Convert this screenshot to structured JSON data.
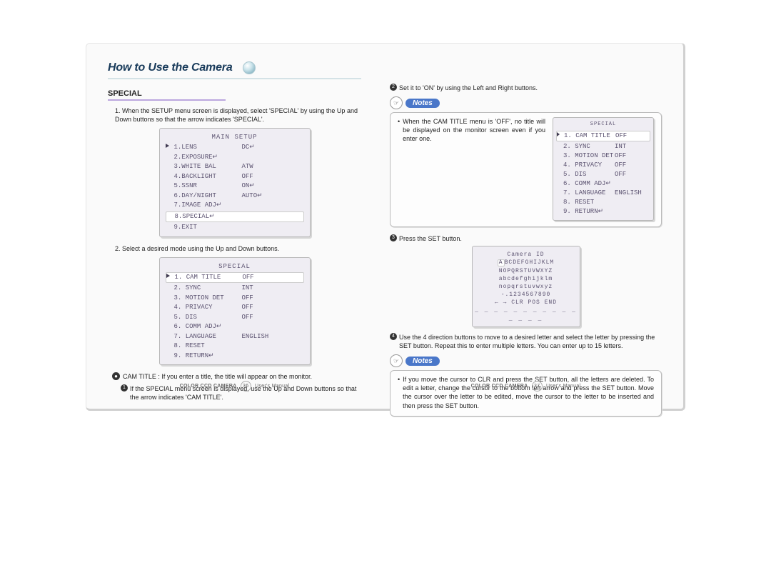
{
  "header": {
    "title": "How to Use the Camera"
  },
  "left": {
    "section_heading": "SPECIAL",
    "step1": "When the SETUP menu screen is displayed, select 'SPECIAL' by using the Up and Down buttons so that the arrow indicates 'SPECIAL'.",
    "main_setup": {
      "title": "MAIN SETUP",
      "rows": [
        {
          "k": "1.LENS",
          "v": "DC↵",
          "ptr": true,
          "hl": false
        },
        {
          "k": "2.EXPOSURE↵",
          "v": ""
        },
        {
          "k": "3.WHITE BAL",
          "v": "ATW"
        },
        {
          "k": "4.BACKLIGHT",
          "v": "OFF"
        },
        {
          "k": "5.SSNR",
          "v": "ON↵"
        },
        {
          "k": "6.DAY/NIGHT",
          "v": "AUTO↵"
        },
        {
          "k": "7.IMAGE ADJ↵",
          "v": ""
        },
        {
          "k": "8.SPECIAL↵",
          "v": "",
          "hl": true
        },
        {
          "k": "9.EXIT",
          "v": ""
        }
      ]
    },
    "step2": "Select a desired mode using the Up and Down buttons.",
    "special_menu": {
      "title": "SPECIAL",
      "rows": [
        {
          "k": "1. CAM TITLE",
          "v": "OFF",
          "ptr": true,
          "hl": true
        },
        {
          "k": "2. SYNC",
          "v": "INT"
        },
        {
          "k": "3. MOTION DET",
          "v": "OFF"
        },
        {
          "k": "4. PRIVACY",
          "v": "OFF"
        },
        {
          "k": "5. DIS",
          "v": "OFF"
        },
        {
          "k": "6. COMM ADJ↵",
          "v": ""
        },
        {
          "k": "7. LANGUAGE",
          "v": "ENGLISH"
        },
        {
          "k": "8. RESET",
          "v": ""
        },
        {
          "k": "9. RETURN↵",
          "v": ""
        }
      ]
    },
    "cam_title_line": "CAM TITLE : If you enter a title, the title will appear on the monitor.",
    "cam_title_sub1": "If the SPECIAL menu screen is displayed, use the Up and Down buttons so that the arrow indicates 'CAM TITLE'."
  },
  "right": {
    "step2": "Set it to 'ON' by using the Left and Right buttons.",
    "notes_label": "Notes",
    "note1_text": "When the CAM TITLE menu is 'OFF', no title will be displayed on the monitor screen even if you enter one.",
    "special_small": {
      "title": "SPECIAL",
      "rows": [
        {
          "k": "1. CAM TITLE",
          "v": "OFF",
          "ptr": true,
          "hl": true
        },
        {
          "k": "2. SYNC",
          "v": "INT"
        },
        {
          "k": "3. MOTION DET",
          "v": "OFF"
        },
        {
          "k": "4. PRIVACY",
          "v": "OFF"
        },
        {
          "k": "5. DIS",
          "v": "OFF"
        },
        {
          "k": "6. COMM ADJ↵",
          "v": ""
        },
        {
          "k": "7. LANGUAGE",
          "v": "ENGLISH"
        },
        {
          "k": "8. RESET",
          "v": ""
        },
        {
          "k": "9. RETURN↵",
          "v": ""
        }
      ]
    },
    "step3": "Press the SET button.",
    "camera_id": {
      "title": "Camera ID",
      "line1_sel": "A",
      "line1_rest": "BCDEFGHIJKLM",
      "line2": "NOPQRSTUVWXYZ",
      "line3": "abcdefghijklm",
      "line4": "nopqrstuvwxyz",
      "line5": "-.1234567890",
      "line6": "← → CLR POS END",
      "line7": "_ _ _ _ _ _ _ _ _ _ _ _ _ _ _"
    },
    "step4": "Use the 4 direction buttons to move to a desired letter and select the letter by pressing the SET button. Repeat this to enter multiple letters. You can enter up to 15 letters.",
    "note2_text": "If you move the cursor to CLR and press the SET button, all the letters are deleted. To edit a letter, change the cursor to the bottom left arrow and press the SET button. Move the cursor over the letter to be edited, move the cursor to the letter to be inserted and then press the SET button."
  },
  "footer": {
    "product": "COLOR CCD CAMERA",
    "suffix": "User's Manual",
    "page_left": "36",
    "page_right": "37"
  }
}
